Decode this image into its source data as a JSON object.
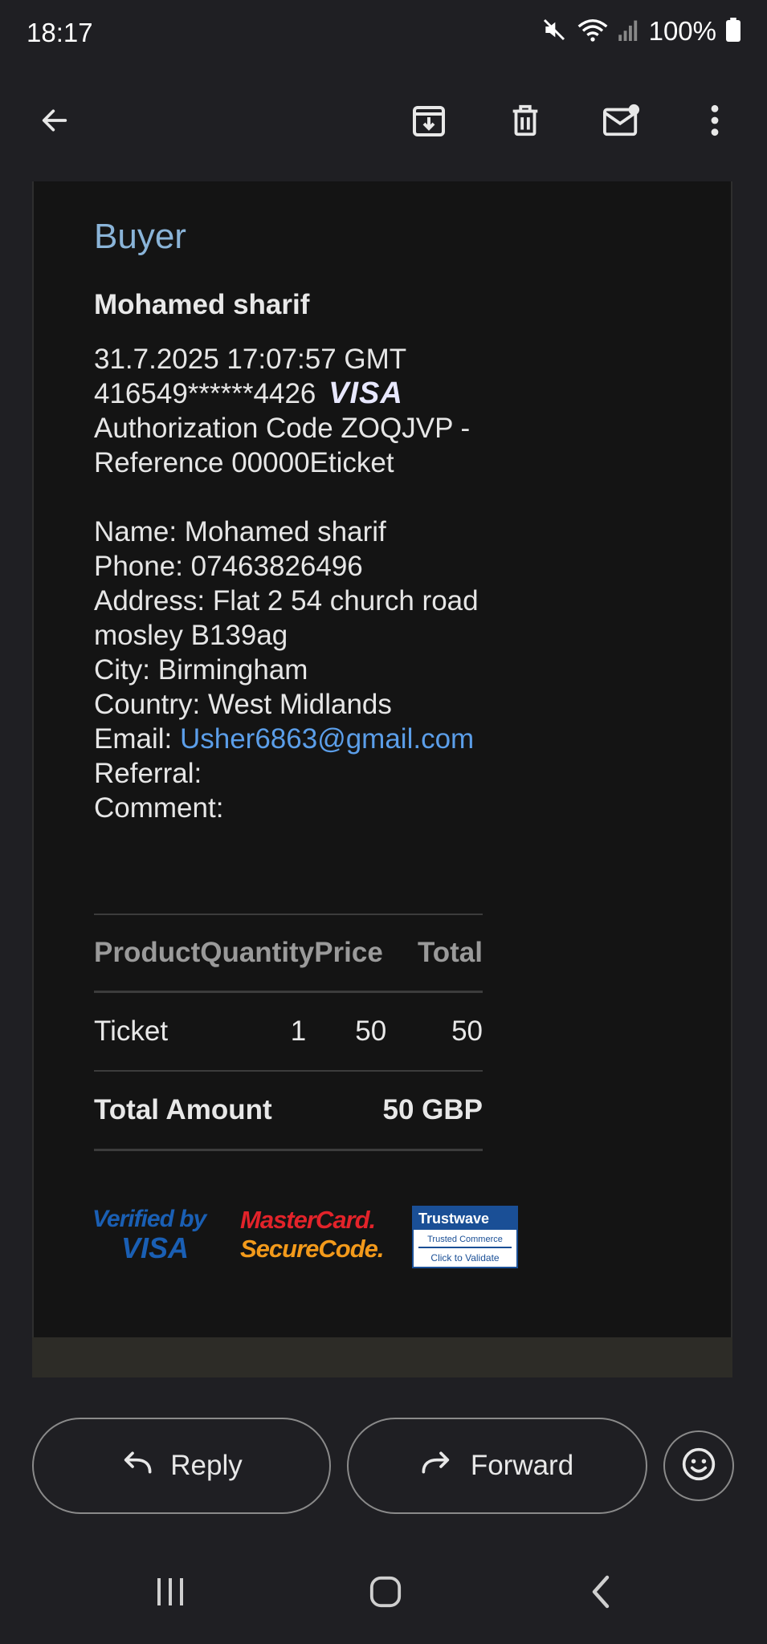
{
  "status_bar": {
    "time": "18:17",
    "battery": "100%",
    "icons": [
      "mute-icon",
      "wifi-icon",
      "signal-icon",
      "battery-icon"
    ]
  },
  "toolbar": {
    "icons": [
      "back-arrow-icon",
      "archive-icon",
      "trash-icon",
      "mark-unread-icon",
      "more-vert-icon"
    ]
  },
  "email": {
    "heading": "Buyer",
    "buyer_name": "Mohamed sharif",
    "payment": {
      "datetime": "31.7.2025 17:07:57 GMT",
      "card_number": "416549******4426",
      "card_brand": "VISA",
      "auth_line": "Authorization Code ZOQJVP -",
      "reference_line": "Reference 00000Eticket"
    },
    "details": {
      "name": "Name: Mohamed sharif",
      "phone": "Phone: 07463826496",
      "address_1": "Address: Flat 2 54 church road",
      "address_2": "mosley B139ag",
      "city": "City: Birmingham",
      "country": "Country: West Midlands",
      "email_label": "Email: ",
      "email_value": "Usher6863@gmail.com",
      "referral": "Referral:",
      "comment": "Comment:"
    },
    "table": {
      "headers": [
        "Product",
        "Quantity",
        "Price",
        "Total"
      ],
      "rows": [
        {
          "product": "Ticket",
          "quantity": "1",
          "price": "50",
          "total": "50"
        }
      ],
      "total_label": "Total Amount",
      "total_value": "50 GBP"
    },
    "logos": {
      "vbv_line1": "Verified by",
      "vbv_line2": "VISA",
      "mc_line1": "MasterCard.",
      "mc_line2": "SecureCode.",
      "tw_line1": "Trustwave",
      "tw_line2": "Trusted Commerce",
      "tw_line3": "Click to Validate"
    }
  },
  "actions": {
    "reply": "Reply",
    "forward": "Forward"
  },
  "colors": {
    "background": "#1f1f23",
    "card": "#141414",
    "heading": "#8ab4d8",
    "link": "#5b9ee9"
  }
}
